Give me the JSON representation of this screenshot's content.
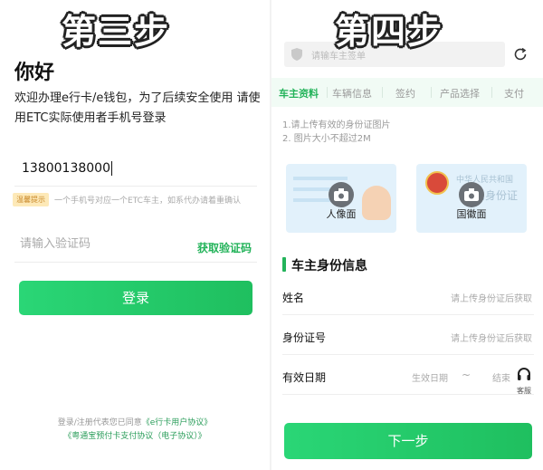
{
  "left_panel": {
    "step_title": "第三步",
    "greeting": "你好",
    "welcome_text": "欢迎办理e行卡/e钱包，为了后续安全使用 请使用ETC实际使用者手机号登录",
    "phone_value": "13800138000",
    "tip_badge": "温馨提示",
    "tip_text": "一个手机号对应一个ETC车主，如系代办请着重确认",
    "code_placeholder": "请输入验证码",
    "get_code_label": "获取验证码",
    "login_label": "登录",
    "agreement_line1_prefix": "登录/注册代表您已同意",
    "agreement_line1_link": "《e行卡用户协议》",
    "agreement_line2": "《粤通宝预付卡支付协议（电子协议）》"
  },
  "right_panel": {
    "step_title": "第四步",
    "search_placeholder": "请输车主签单",
    "tabs": [
      {
        "label": "车主资料",
        "active": true
      },
      {
        "label": "车辆信息",
        "active": false
      },
      {
        "label": "签约",
        "active": false
      },
      {
        "label": "产品选择",
        "active": false
      },
      {
        "label": "支付",
        "active": false
      }
    ],
    "upload_note_1": "1.请上传有效的身份证图片",
    "upload_note_2": "2. 图片大小不超过2M",
    "card_front_label": "人像面",
    "card_back_label": "国徽面",
    "card_back_text_1": "中华人民共和国",
    "card_back_text_2": "居民身份证",
    "section_title": "车主身份信息",
    "fields": [
      {
        "label": "姓名",
        "hint": "请上传身份证后获取"
      },
      {
        "label": "身份证号",
        "hint": "请上传身份证后获取"
      }
    ],
    "validity_label": "有效日期",
    "validity_start": "生效日期",
    "validity_sep": "~",
    "validity_end": "结束",
    "support_label": "客服",
    "next_label": "下一步"
  },
  "colors": {
    "accent": "#23b35a",
    "button_gradient_start": "#2ad676",
    "button_gradient_end": "#1fbf5f",
    "tip_badge_bg": "#fde9b8",
    "tab_bar_bg": "#f1fbf5"
  },
  "icons": [
    "shield-icon",
    "refresh-icon",
    "camera-icon",
    "headset-icon"
  ]
}
